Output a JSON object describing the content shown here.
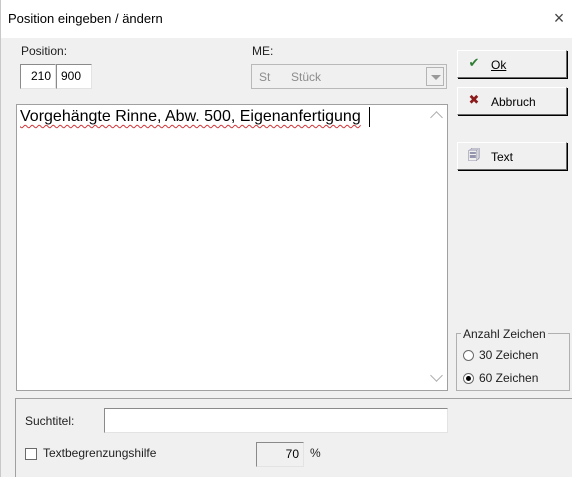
{
  "window": {
    "title": "Position eingeben / ändern",
    "close_glyph": "×"
  },
  "position": {
    "label": "Position:",
    "part1": "210",
    "part2": "900"
  },
  "me": {
    "label": "ME:",
    "code": "St",
    "text": "Stück"
  },
  "memo": {
    "text": "Vorgehängte Rinne, Abw. 500, Eigenanfertigung"
  },
  "buttons": {
    "ok": {
      "label": "Ok",
      "icon": "checkmark-icon",
      "icon_glyph": "✔",
      "icon_color": "#2e7d32"
    },
    "abbruch": {
      "label": "Abbruch",
      "icon": "x-icon",
      "icon_glyph": "✖",
      "icon_color": "#8b1a1a"
    },
    "text": {
      "label": "Text",
      "icon": "text-page-icon",
      "icon_glyph": "🗐"
    }
  },
  "anzahl_zeichen": {
    "title": "Anzahl Zeichen",
    "options": [
      {
        "label": "30 Zeichen",
        "selected": false
      },
      {
        "label": "60 Zeichen",
        "selected": true
      }
    ]
  },
  "suchtitel": {
    "label": "Suchtitel:",
    "value": ""
  },
  "textbegrenzung": {
    "label": "Textbegrenzungshilfe",
    "checked": false,
    "value": "70",
    "unit": "%"
  }
}
